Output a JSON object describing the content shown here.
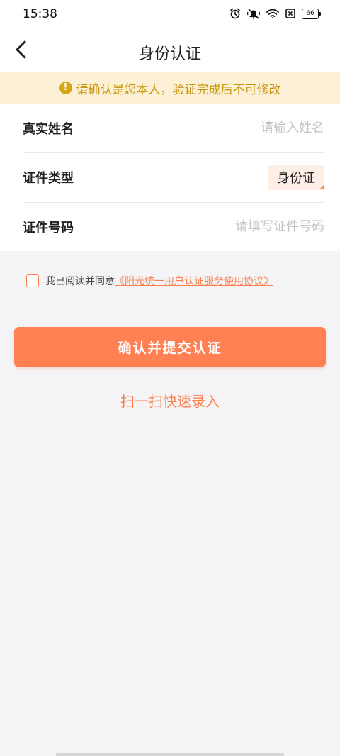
{
  "status_bar": {
    "time": "15:38",
    "battery": "66"
  },
  "nav": {
    "title": "身份认证"
  },
  "notice": {
    "icon": "!",
    "text": "请确认是您本人，验证完成后不可修改"
  },
  "form": {
    "name": {
      "label": "真实姓名",
      "value": "",
      "placeholder": "请输入姓名"
    },
    "id_type": {
      "label": "证件类型",
      "value": "身份证"
    },
    "id_number": {
      "label": "证件号码",
      "value": "",
      "placeholder": "请填写证件号码"
    }
  },
  "agreement": {
    "checked": false,
    "prefix": "我已阅读并同意",
    "link_text": "《阳光统一用户认证服务使用协议》"
  },
  "actions": {
    "submit_label": "确认并提交认证",
    "scan_label": "扫一扫快速录入"
  },
  "colors": {
    "accent": "#ff7f4c",
    "notice_bg": "#fcf1d6",
    "notice_text": "#c8950d",
    "page_bg": "#f4f4f6"
  },
  "icons": {
    "back": "chevron-left-icon",
    "alarm": "alarm-icon",
    "mute": "bell-off-icon",
    "wifi": "wifi-icon",
    "sim": "sim-icon",
    "battery": "battery-icon",
    "notice": "exclamation-circle-icon"
  }
}
